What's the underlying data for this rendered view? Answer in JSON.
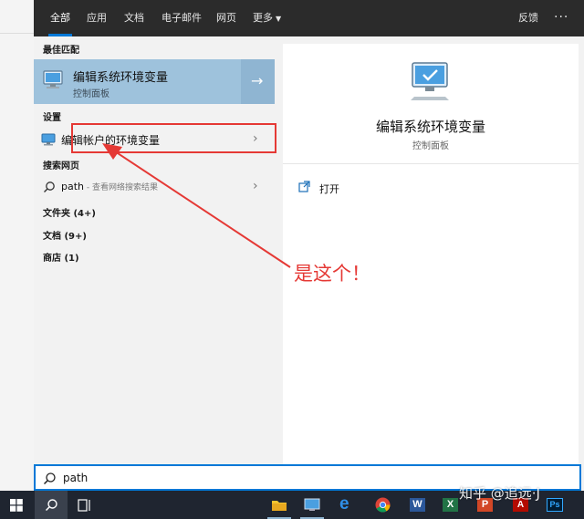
{
  "tabs": [
    "全部",
    "应用",
    "文档",
    "电子邮件",
    "网页",
    "更多"
  ],
  "feedback": "反馈",
  "more_dots": "···",
  "sections": {
    "best_match": "最佳匹配",
    "settings": "设置",
    "web_search": "搜索网页"
  },
  "best_match": {
    "title": "编辑系统环境变量",
    "subtitle": "控制面板"
  },
  "settings_item": {
    "label": "编辑帐户的环境变量"
  },
  "web_item": {
    "query": "path",
    "hint": " - 查看网络搜索结果"
  },
  "categories": [
    "文件夹 (4+)",
    "文档 (9+)",
    "商店 (1)"
  ],
  "preview": {
    "title": "编辑系统环境变量",
    "subtitle": "控制面板",
    "open_label": "打开"
  },
  "annotation": "是这个！",
  "search": {
    "value": "path"
  },
  "watermark": "知乎 @追远·J",
  "colors": {
    "accent": "#0078d7",
    "annotation": "#e53935",
    "best_match_bg": "#9ec2dc",
    "topbar": "#2b2b2b",
    "taskbar": "#1f2530"
  },
  "taskbar_icons": [
    "windows-logo-icon",
    "search-icon",
    "task-view-icon",
    "file-explorer-icon",
    "control-panel-icon",
    "edge-icon",
    "chrome-icon",
    "word-icon",
    "excel-icon",
    "powerpoint-icon",
    "acrobat-icon",
    "photoshop-icon"
  ]
}
